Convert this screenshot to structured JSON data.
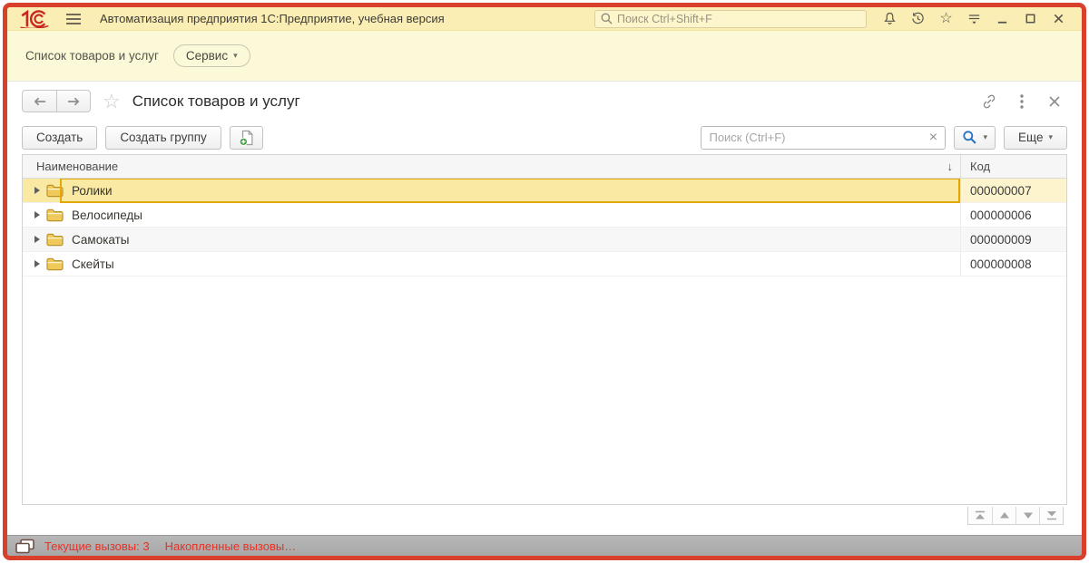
{
  "titlebar": {
    "app_title": "Автоматизация предприятия 1С:Предприятие, учебная версия",
    "search_placeholder": "Поиск Ctrl+Shift+F",
    "search_value": ""
  },
  "funcpanel": {
    "open_window_label": "Список товаров и услуг",
    "service_button_label": "Сервис"
  },
  "form": {
    "title": "Список товаров и услуг",
    "create_button_label": "Создать",
    "create_group_button_label": "Создать группу",
    "more_button_label": "Еще",
    "search_placeholder": "Поиск (Ctrl+F)",
    "search_value": ""
  },
  "table": {
    "columns": [
      {
        "label": "Наименование"
      },
      {
        "label": "Код"
      }
    ],
    "rows": [
      {
        "name": "Ролики",
        "code": "000000007",
        "selected": true
      },
      {
        "name": "Велосипеды",
        "code": "000000006",
        "selected": false
      },
      {
        "name": "Самокаты",
        "code": "000000009",
        "selected": false
      },
      {
        "name": "Скейты",
        "code": "000000008",
        "selected": false
      }
    ]
  },
  "statusbar": {
    "current_calls": "Текущие вызовы: 3",
    "accumulated_calls": "Накопленные вызовы…"
  },
  "icons": {
    "caret_down": "▾",
    "sort_descending": "↓",
    "star_outline": "☆",
    "clear_x": "×"
  },
  "colors": {
    "window_border": "#d8402c",
    "titlebar_bg": "#fbeeb5",
    "funcpanel_bg": "#fcf9d8",
    "selected_row_bg": "#fae9a3",
    "selected_row_border": "#e3a900",
    "status_text": "#e43327",
    "logo_red": "#c8281e",
    "find_icon_blue": "#2470c2"
  }
}
